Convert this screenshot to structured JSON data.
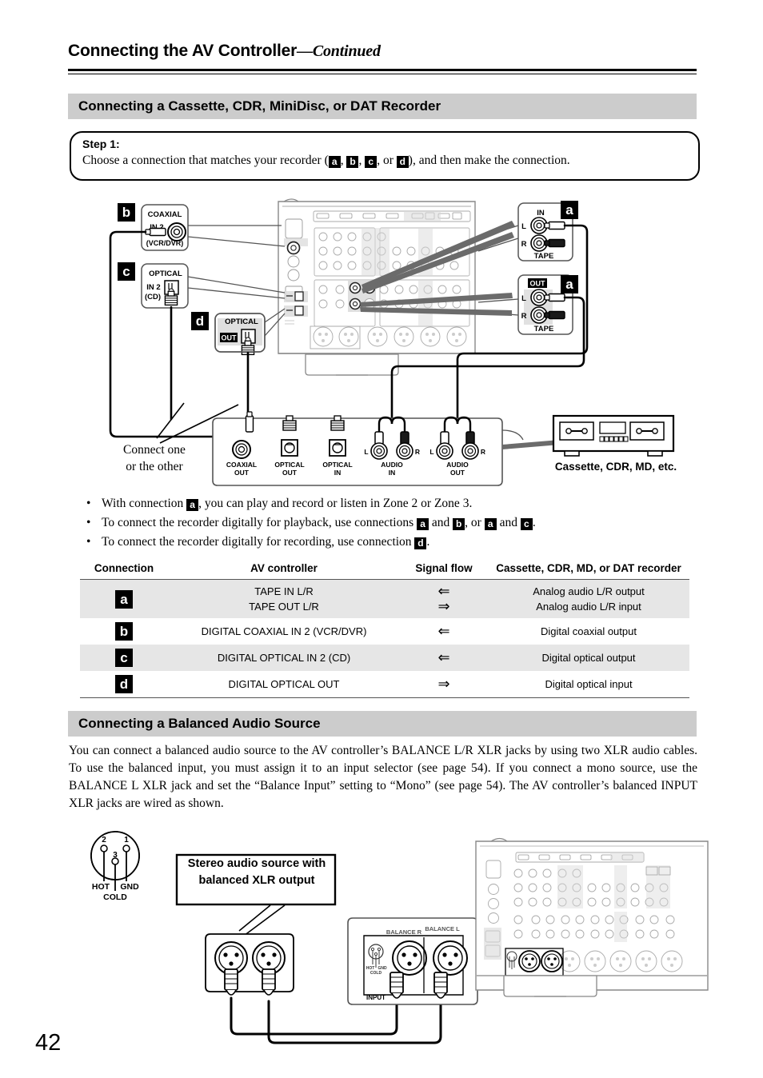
{
  "header": {
    "title_main": "Connecting the AV Controller",
    "title_continued": "—Continued"
  },
  "section1": {
    "heading": "Connecting a Cassette, CDR, MiniDisc, or DAT Recorder",
    "step": {
      "label": "Step 1:",
      "text_before": "Choose a connection that matches your recorder (",
      "chip_a": "a",
      "sep1": ", ",
      "chip_b": "b",
      "sep2": ", ",
      "chip_c": "c",
      "sep3": ", or ",
      "chip_d": "d",
      "text_after": "), and then make the connection."
    }
  },
  "diagram": {
    "chip_a": "a",
    "chip_b": "b",
    "chip_c": "c",
    "chip_d": "d",
    "coaxial_box": {
      "title": "COAXIAL",
      "in_label": "IN 2",
      "sub_label": "(VCR/DVR)"
    },
    "optical_in_box": {
      "title": "OPTICAL",
      "in_label": "IN 2",
      "sub_label": "(CD)"
    },
    "optical_out_box": {
      "title": "OPTICAL",
      "out_label": "OUT"
    },
    "tape_in_box": {
      "title": "IN",
      "left": "L",
      "right": "R",
      "bottom": "TAPE"
    },
    "tape_out_box": {
      "title": "OUT",
      "left": "L",
      "right": "R",
      "bottom": "TAPE"
    },
    "connect_note_line1": "Connect one",
    "connect_note_line2": "or the other",
    "recorder_panel": {
      "jacks": [
        {
          "line1": "COAXIAL",
          "line2": "OUT"
        },
        {
          "line1": "OPTICAL",
          "line2": "OUT"
        },
        {
          "line1": "OPTICAL",
          "line2": "IN"
        },
        {
          "line1": "AUDIO",
          "line2": "IN",
          "l": "L",
          "r": "R"
        },
        {
          "line1": "AUDIO",
          "line2": "OUT",
          "l": "L",
          "r": "R"
        }
      ]
    },
    "device_caption": "Cassette, CDR, MD, etc."
  },
  "bullets": [
    {
      "parts": [
        "With connection ",
        ", you can play and record or listen in Zone 2 or Zone 3."
      ],
      "chips": [
        "a"
      ]
    },
    {
      "parts": [
        "To connect the recorder digitally for playback, use connections ",
        " and ",
        ", or ",
        " and ",
        "."
      ],
      "chips": [
        "a",
        "b",
        "a",
        "c"
      ]
    },
    {
      "parts": [
        "To connect the recorder digitally for recording, use connection ",
        "."
      ],
      "chips": [
        "d"
      ]
    }
  ],
  "table": {
    "headers": [
      "Connection",
      "AV controller",
      "Signal flow",
      "Cassette, CDR, MD, or DAT recorder"
    ],
    "rows": [
      {
        "chip": "a",
        "av_line1": "TAPE IN L/R",
        "av_line2": "TAPE OUT L/R",
        "flow_line1": "⇐",
        "flow_line2": "⇒",
        "rec_line1": "Analog audio L/R output",
        "rec_line2": "Analog audio L/R input"
      },
      {
        "chip": "b",
        "av_line1": "DIGITAL COAXIAL IN 2 (VCR/DVR)",
        "flow_line1": "⇐",
        "rec_line1": "Digital coaxial output"
      },
      {
        "chip": "c",
        "av_line1": "DIGITAL OPTICAL IN 2 (CD)",
        "flow_line1": "⇐",
        "rec_line1": "Digital optical output"
      },
      {
        "chip": "d",
        "av_line1": "DIGITAL OPTICAL OUT",
        "flow_line1": "⇒",
        "rec_line1": "Digital optical input"
      }
    ]
  },
  "section2": {
    "heading": "Connecting a Balanced Audio Source",
    "paragraph": "You can connect a balanced audio source to the AV controller’s BALANCE L/R XLR jacks by using two XLR audio cables. To use the balanced input, you must assign it to an input selector (see page 54). If you connect a mono source, use the BALANCE L XLR jack and set the “Balance Input” setting to “Mono” (see page 54). The AV controller’s balanced INPUT XLR jacks are wired as shown.",
    "pinout": {
      "pin1": "1",
      "pin2": "2",
      "pin3": "3",
      "hot": "HOT",
      "gnd": "GND",
      "cold": "COLD"
    },
    "source_box_line1": "Stereo audio source with",
    "source_box_line2": "balanced XLR output",
    "panel_labels": {
      "balance_r": "BALANCE R",
      "balance_l": "BALANCE L",
      "input": "INPUT"
    }
  },
  "page_number": "42",
  "colors": {
    "bar_grey": "#cccccc",
    "row_grey": "#e6e6e6",
    "panel_grey": "#d9d9d9",
    "ink": "#000000"
  }
}
